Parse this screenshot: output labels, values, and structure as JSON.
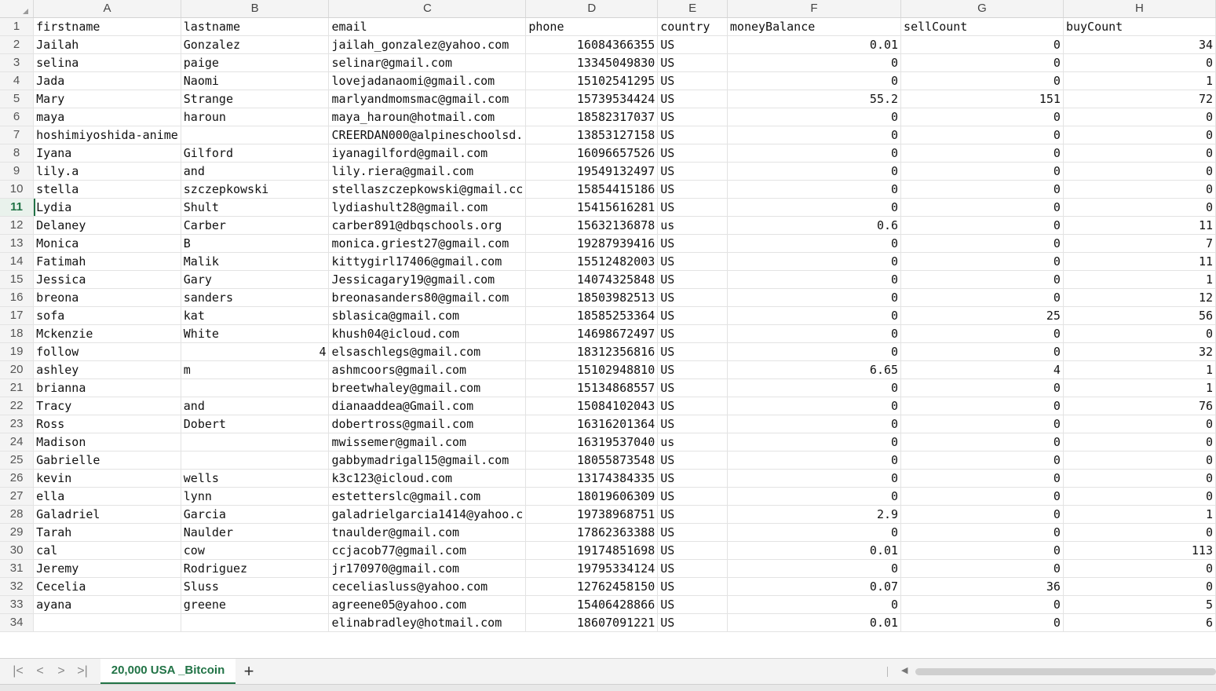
{
  "columns": [
    "A",
    "B",
    "C",
    "D",
    "E",
    "F",
    "G",
    "H"
  ],
  "rows": [
    [
      "firstname",
      "lastname",
      "email",
      "phone",
      "country",
      "moneyBalance",
      "sellCount",
      "buyCount"
    ],
    [
      "Jailah",
      "Gonzalez",
      "jailah_gonzalez@yahoo.com",
      "16084366355",
      "US",
      "0.01",
      "0",
      "34"
    ],
    [
      "selina",
      "paige",
      "selinar@gmail.com",
      "13345049830",
      "US",
      "0",
      "0",
      "0"
    ],
    [
      "Jada",
      "Naomi",
      "lovejadanaomi@gmail.com",
      "15102541295",
      "US",
      "0",
      "0",
      "1"
    ],
    [
      "Mary",
      "Strange",
      "marlyandmomsmac@gmail.com",
      "15739534424",
      "US",
      "55.2",
      "151",
      "72"
    ],
    [
      "maya",
      "haroun",
      "maya_haroun@hotmail.com",
      "18582317037",
      "US",
      "0",
      "0",
      "0"
    ],
    [
      "hoshimiyoshida-anime",
      "",
      "CREERDAN000@alpineschoolsd.",
      "13853127158",
      "US",
      "0",
      "0",
      "0"
    ],
    [
      "Iyana",
      "Gilford",
      "iyanagilford@gmail.com",
      "16096657526",
      "US",
      "0",
      "0",
      "0"
    ],
    [
      "lily.a",
      "and",
      "lily.riera@gmail.com",
      "19549132497",
      "US",
      "0",
      "0",
      "0"
    ],
    [
      "stella",
      "szczepkowski",
      "stellaszczepkowski@gmail.cc",
      "15854415186",
      "US",
      "0",
      "0",
      "0"
    ],
    [
      "Lydia",
      "Shult",
      "lydiashult28@gmail.com",
      "15415616281",
      "US",
      "0",
      "0",
      "0"
    ],
    [
      "Delaney",
      "Carber",
      "carber891@dbqschools.org",
      "15632136878",
      "us",
      "0.6",
      "0",
      "11"
    ],
    [
      "Monica",
      "B",
      "monica.griest27@gmail.com",
      "19287939416",
      "US",
      "0",
      "0",
      "7"
    ],
    [
      "Fatimah",
      "Malik",
      "kittygirl17406@gmail.com",
      "15512482003",
      "US",
      "0",
      "0",
      "11"
    ],
    [
      "Jessica",
      "Gary",
      "Jessicagary19@gmail.com",
      "14074325848",
      "US",
      "0",
      "0",
      "1"
    ],
    [
      "breona",
      "sanders",
      "breonasanders80@gmail.com",
      "18503982513",
      "US",
      "0",
      "0",
      "12"
    ],
    [
      "sofa",
      "kat",
      "sblasica@gmail.com",
      "18585253364",
      "US",
      "0",
      "25",
      "56"
    ],
    [
      "Mckenzie",
      "White",
      "khush04@icloud.com",
      "14698672497",
      "US",
      "0",
      "0",
      "0"
    ],
    [
      "follow",
      "4",
      "elsaschlegs@gmail.com",
      "18312356816",
      "US",
      "0",
      "0",
      "32"
    ],
    [
      "ashley",
      "m",
      "ashmcoors@gmail.com",
      "15102948810",
      "US",
      "6.65",
      "4",
      "1"
    ],
    [
      "brianna",
      "",
      "breetwhaley@gmail.com",
      "15134868557",
      "US",
      "0",
      "0",
      "1"
    ],
    [
      "Tracy",
      "and",
      "dianaaddea@Gmail.com",
      "15084102043",
      "US",
      "0",
      "0",
      "76"
    ],
    [
      "Ross",
      "Dobert",
      "dobertross@gmail.com",
      "16316201364",
      "US",
      "0",
      "0",
      "0"
    ],
    [
      "Madison",
      "",
      "mwissemer@gmail.com",
      "16319537040",
      "us",
      "0",
      "0",
      "0"
    ],
    [
      "Gabrielle",
      "",
      "gabbymadrigal15@gmail.com",
      "18055873548",
      "US",
      "0",
      "0",
      "0"
    ],
    [
      "kevin",
      "wells",
      "k3c123@icloud.com",
      "13174384335",
      "US",
      "0",
      "0",
      "0"
    ],
    [
      "ella",
      "lynn",
      "estetterslc@gmail.com",
      "18019606309",
      "US",
      "0",
      "0",
      "0"
    ],
    [
      "Galadriel",
      "Garcia",
      "galadrielgarcia1414@yahoo.c",
      "19738968751",
      "US",
      "2.9",
      "0",
      "1"
    ],
    [
      "Tarah",
      "Naulder",
      "tnaulder@gmail.com",
      "17862363388",
      "US",
      "0",
      "0",
      "0"
    ],
    [
      "cal",
      "cow",
      "ccjacob77@gmail.com",
      "19174851698",
      "US",
      "0.01",
      "0",
      "113"
    ],
    [
      "Jeremy",
      "Rodriguez",
      "jr170970@gmail.com",
      "19795334124",
      "US",
      "0",
      "0",
      "0"
    ],
    [
      "Cecelia",
      "Sluss",
      "ceceliasluss@yahoo.com",
      "12762458150",
      "US",
      "0.07",
      "36",
      "0"
    ],
    [
      "ayana",
      "greene",
      "agreene05@yahoo.com",
      "15406428866",
      "US",
      "0",
      "0",
      "5"
    ],
    [
      "",
      "",
      "elinabradley@hotmail.com",
      "18607091221",
      "US",
      "0.01",
      "0",
      "6"
    ]
  ],
  "active_row": 11,
  "sheet_tab": "20,000 USA _Bitcoin",
  "nav": {
    "first": "|<",
    "prev": "<",
    "next": ">",
    "last": ">|",
    "add": "+"
  },
  "accent_color": "#217346"
}
